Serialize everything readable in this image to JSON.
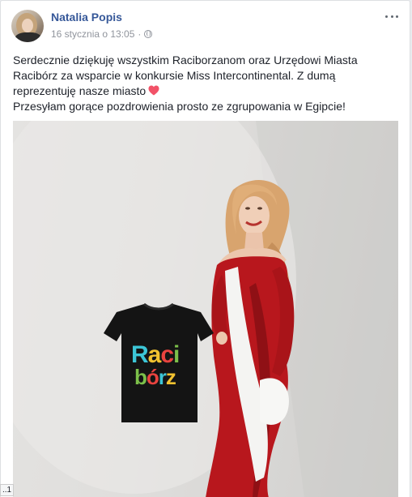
{
  "post": {
    "author": "Natalia Popis",
    "timestamp": "16 stycznia o 13:05",
    "separator": "·",
    "privacy_icon": "globe-icon",
    "menu_icon": "more-options-icon",
    "text_line1": "Serdecznie dziękuję wszystkim Raciborzanom oraz Urzędowi Miasta Racibórz za wsparcie w konkursie Miss Intercontinental. Z dumą reprezentuję nasze miasto",
    "emoji": "heart-icon",
    "text_line2": "Przesyłam gorące pozdrowienia prosto ze zgrupowania w Egipcie!",
    "accent_color": "#365899",
    "heart_color": "#f25268"
  },
  "photo": {
    "shirt_text_line1": "Raci",
    "shirt_text_line2": "bórz"
  },
  "status_bar": {
    "label": "..1"
  }
}
